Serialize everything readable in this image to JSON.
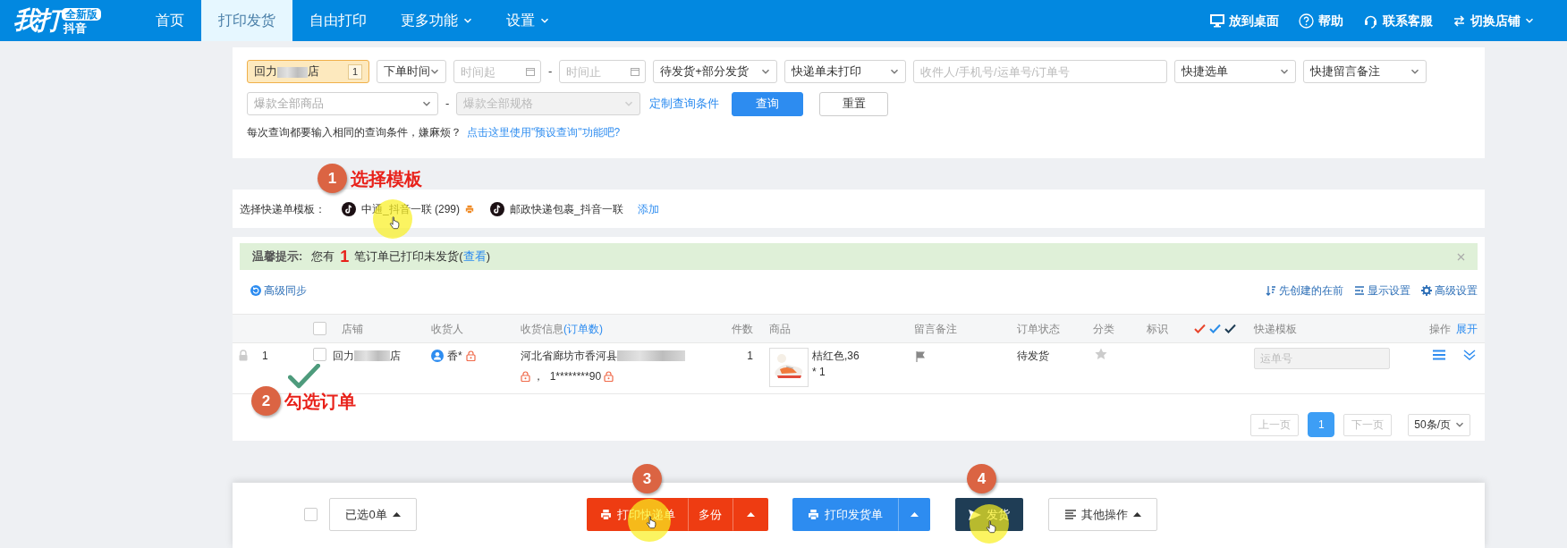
{
  "nav": {
    "logo": {
      "main": "我打",
      "badge": "全新版",
      "sub": "抖音"
    },
    "items": [
      {
        "label": "首页",
        "selected": false,
        "dropdown": false
      },
      {
        "label": "打印发货",
        "selected": true,
        "dropdown": false
      },
      {
        "label": "自由打印",
        "selected": false,
        "dropdown": false
      },
      {
        "label": "更多功能",
        "selected": false,
        "dropdown": true
      },
      {
        "label": "设置",
        "selected": false,
        "dropdown": true
      }
    ],
    "right": [
      {
        "label": "放到桌面",
        "dropdown": false
      },
      {
        "label": "帮助",
        "dropdown": false
      },
      {
        "label": "联系客服",
        "dropdown": false
      },
      {
        "label": "切换店铺",
        "dropdown": true
      }
    ]
  },
  "filters": {
    "row1": [
      {
        "kind": "shop",
        "name_start": "回力",
        "name_end": "店",
        "count": "1"
      },
      {
        "kind": "select",
        "value": "下单时间"
      },
      {
        "kind": "date",
        "placeholder": "时间起"
      },
      {
        "kind": "separator",
        "text": "-"
      },
      {
        "kind": "date",
        "placeholder": "时间止"
      },
      {
        "kind": "select",
        "value": "待发货+部分发货"
      },
      {
        "kind": "select",
        "value": "快递单未打印"
      },
      {
        "kind": "input",
        "placeholder": "收件人/手机号/运单号/订单号"
      },
      {
        "kind": "select",
        "value": "快捷选单"
      },
      {
        "kind": "select",
        "value": "快捷留言备注"
      }
    ],
    "row2": [
      {
        "kind": "select",
        "placeholder": "爆款全部商品",
        "disabled": false
      },
      {
        "kind": "separator",
        "text": "-"
      },
      {
        "kind": "select",
        "placeholder": "爆款全部规格",
        "disabled": true
      },
      {
        "kind": "link",
        "text": "定制查询条件"
      },
      {
        "kind": "button",
        "text": "查询",
        "primary": true
      },
      {
        "kind": "button",
        "text": "重置",
        "primary": false
      }
    ],
    "hint": {
      "text": "每次查询都要输入相同的查询条件，嫌麻烦？",
      "link": "点击这里使用\"预设查询\"功能吧?"
    }
  },
  "templates": {
    "label": "选择快递单模板：",
    "items": [
      {
        "name": "中通_抖音一联 (299)",
        "default": true
      },
      {
        "name": "邮政快递包裹_抖音一联",
        "default": false
      }
    ],
    "add": "添加"
  },
  "alert": {
    "title": "温馨提示:",
    "before": "您有",
    "count": "1",
    "after": "笔订单已打印未发货(",
    "link": "查看",
    "end": ")"
  },
  "toolbar": {
    "sync": "高级同步",
    "right": [
      {
        "label": "先创建的在前"
      },
      {
        "label": "显示设置"
      },
      {
        "label": "高级设置"
      }
    ]
  },
  "table": {
    "header_checkbox": {
      "checked": false
    },
    "columns": [
      {
        "kind": "text",
        "label": "店铺"
      },
      {
        "kind": "text",
        "label": "收货人"
      },
      {
        "kind": "text",
        "label": "收货信息",
        "link": "(订单数)"
      },
      {
        "kind": "text",
        "label": "件数"
      },
      {
        "kind": "text",
        "label": "商品"
      },
      {
        "kind": "text",
        "label": "留言备注"
      },
      {
        "kind": "text",
        "label": "订单状态"
      },
      {
        "kind": "text",
        "label": "分类"
      },
      {
        "kind": "text",
        "label": "标识"
      },
      {
        "kind": "marks",
        "marks": [
          {
            "color": "#e8452c"
          },
          {
            "color": "#2a8de8"
          },
          {
            "color": "#1f3d55"
          }
        ]
      },
      {
        "kind": "text",
        "label": "快递模板"
      },
      {
        "kind": "text",
        "label": "操作",
        "link": "展开"
      }
    ],
    "rows": [
      {
        "index": "1",
        "locked": true,
        "checked": false,
        "shop_start": "回力",
        "shop_end": "店",
        "receiver": "香*",
        "address": "河北省廊坊市香河县",
        "phone": "，  1********90",
        "count": "1",
        "product": "桔红色,36",
        "qty": "* 1",
        "status": "待发货",
        "starred": false,
        "tracking_placeholder": "运单号"
      }
    ]
  },
  "pagination": {
    "prev": "上一页",
    "pages": [
      {
        "label": "1",
        "selected": true
      }
    ],
    "next": "下一页",
    "per_page": "50条/页"
  },
  "bottom_bar": {
    "select_all": {
      "checked": false
    },
    "selected_count": "已选0单",
    "print_express": "打印快递单",
    "copies": "多份",
    "print_invoice": "打印发货单",
    "ship": "发货",
    "other": "其他操作"
  },
  "annotations": [
    {
      "number": "1",
      "label": "选择模板"
    },
    {
      "number": "2",
      "label": "勾选订单"
    },
    {
      "number": "3"
    },
    {
      "number": "4"
    }
  ]
}
